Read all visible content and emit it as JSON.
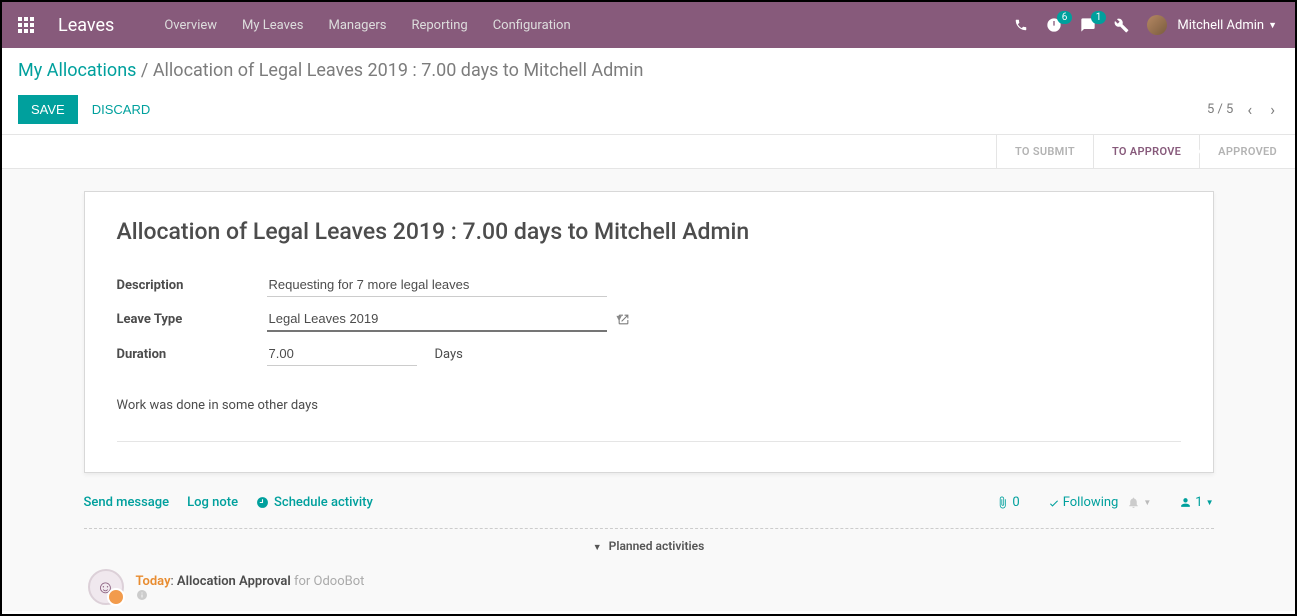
{
  "navbar": {
    "brand": "Leaves",
    "menu": [
      "Overview",
      "My Leaves",
      "Managers",
      "Reporting",
      "Configuration"
    ],
    "activities_badge": "6",
    "messages_badge": "1",
    "user_name": "Mitchell Admin"
  },
  "breadcrumb": {
    "root": "My Allocations",
    "current": "Allocation of Legal Leaves 2019 : 7.00 days to Mitchell Admin"
  },
  "buttons": {
    "save": "SAVE",
    "discard": "DISCARD"
  },
  "pager": {
    "text": "5 / 5"
  },
  "status": {
    "to_submit": "TO SUBMIT",
    "to_approve": "TO APPROVE",
    "approved": "APPROVED"
  },
  "form": {
    "title": "Allocation of Legal Leaves 2019 : 7.00 days to Mitchell Admin",
    "labels": {
      "description": "Description",
      "leave_type": "Leave Type",
      "duration": "Duration"
    },
    "values": {
      "description": "Requesting for 7 more legal leaves",
      "leave_type": "Legal Leaves 2019",
      "duration": "7.00",
      "duration_unit": "Days"
    },
    "reason": "Work was done in some other days"
  },
  "chatter": {
    "send_message": "Send message",
    "log_note": "Log note",
    "schedule_activity": "Schedule activity",
    "attachments": "0",
    "following": "Following",
    "followers": "1",
    "planned_header": "Planned activities",
    "activity": {
      "today": "Today",
      "sep": ": ",
      "title": "Allocation Approval",
      "for": " for ",
      "who": "OdooBot"
    }
  }
}
